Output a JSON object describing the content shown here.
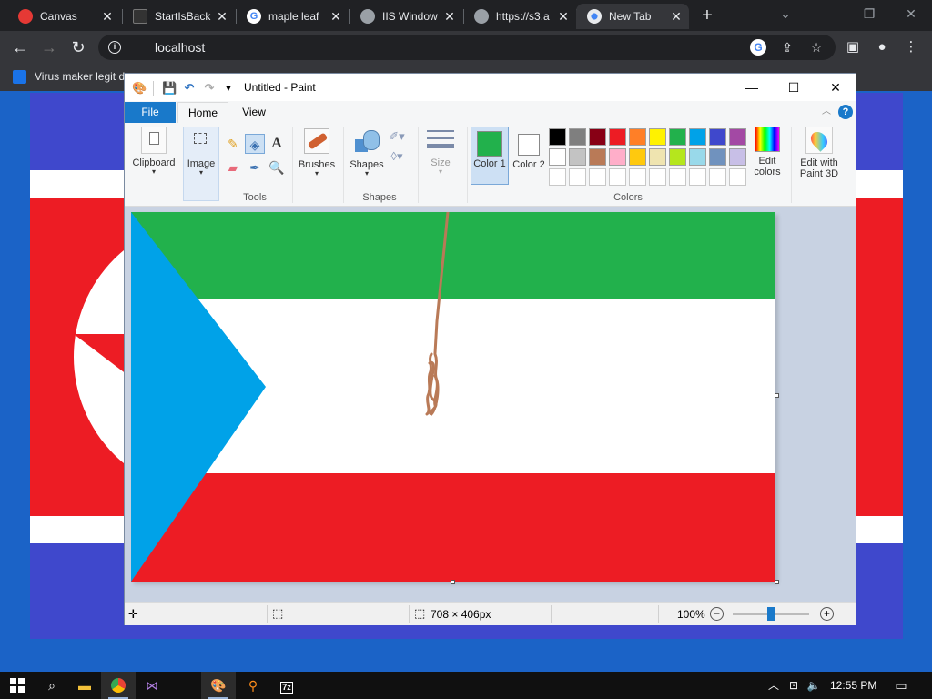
{
  "browser": {
    "tabs": [
      {
        "label": "Canvas",
        "favicon": "canvas-icon",
        "color": "#e53935"
      },
      {
        "label": "StartIsBack",
        "favicon": "startisback-icon",
        "color": "#333333"
      },
      {
        "label": "maple leaf",
        "favicon": "google-icon",
        "color": "#ffffff"
      },
      {
        "label": "IIS Window",
        "favicon": "globe-icon",
        "color": "#9aa0a6"
      },
      {
        "label": "https://s3.a",
        "favicon": "globe-icon",
        "color": "#9aa0a6"
      },
      {
        "label": "New Tab",
        "favicon": "chrome-icon",
        "color": "#e8eaed"
      }
    ],
    "url": "localhost",
    "bookmark": "Virus maker legit d"
  },
  "paint": {
    "title": "Untitled - Paint",
    "tabs": {
      "file": "File",
      "home": "Home",
      "view": "View"
    },
    "groups": {
      "clipboard": "Clipboard",
      "image": "Image",
      "tools": "Tools",
      "brushes": "Brushes",
      "shapes_btn": "Shapes",
      "shapes": "Shapes",
      "size": "Size",
      "colors": "Colors"
    },
    "color1": {
      "label": "Color 1",
      "value": "#22b14c"
    },
    "color2": {
      "label": "Color 2",
      "value": "#ffffff"
    },
    "edit_colors": "Edit colors",
    "edit_3d": "Edit with Paint 3D",
    "palette_row1": [
      "#000000",
      "#7f7f7f",
      "#880015",
      "#ed1c24",
      "#ff7f27",
      "#fff200",
      "#22b14c",
      "#00a2e8",
      "#3f48cc",
      "#a349a4"
    ],
    "palette_row2": [
      "#ffffff",
      "#c3c3c3",
      "#b97a57",
      "#ffaec9",
      "#ffc90e",
      "#efe4b0",
      "#b5e61d",
      "#99d9ea",
      "#7092be",
      "#c8bfe7"
    ],
    "status": {
      "dimensions": "708 × 406px",
      "zoom": "100%",
      "zoom_level": 0.5
    }
  },
  "taskbar": {
    "time": "12:55 PM"
  },
  "colors": {
    "flag_green": "#22b14c",
    "flag_white": "#ffffff",
    "flag_red": "#ed1c24",
    "flag_triangle": "#00a2e8",
    "stroke_brown": "#b97a57",
    "nk_blue": "#3f48cc",
    "nk_red": "#ed1c24"
  }
}
